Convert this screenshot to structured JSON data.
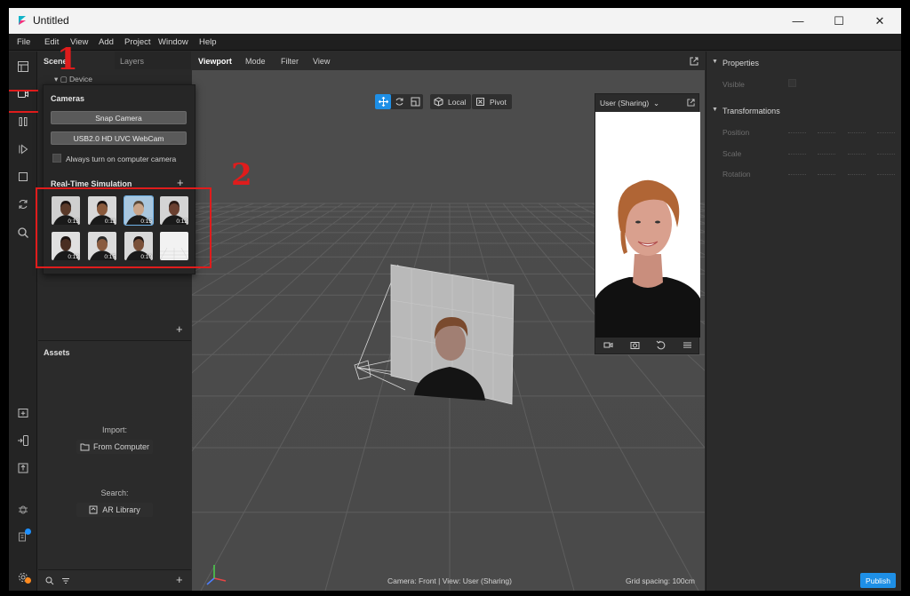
{
  "window": {
    "title": "Untitled",
    "minimize_glyph": "—",
    "maximize_glyph": "☐",
    "close_glyph": "✕"
  },
  "menu": [
    "File",
    "Edit",
    "View",
    "Add",
    "Project",
    "Window",
    "Help"
  ],
  "left_panel": {
    "tabs": [
      "Scene",
      "Layers"
    ],
    "device_label": "Device"
  },
  "cameras_popover": {
    "title": "Cameras",
    "snap_camera": "Snap Camera",
    "webcam": "USB2.0 HD UVC WebCam",
    "always_on_label": "Always turn on computer camera",
    "simulation_title": "Real-Time Simulation",
    "thumbnails": [
      {
        "duration": "0:13",
        "skin": "#5a3a2a",
        "hair": "#1a1210",
        "bg": "#cfcfcf"
      },
      {
        "duration": "0:11",
        "skin": "#8a5a3c",
        "hair": "#1a1210",
        "bg": "#d8d8d8"
      },
      {
        "duration": "0:15",
        "skin": "#c9a58a",
        "hair": "#5a4a3a",
        "bg": "#a9c7df"
      },
      {
        "duration": "0:12",
        "skin": "#6a4030",
        "hair": "#2a1a14",
        "bg": "#d4d4d4"
      },
      {
        "duration": "0:12",
        "skin": "#4a2e22",
        "hair": "#1a1210",
        "bg": "#e0e0e0"
      },
      {
        "duration": "0:15",
        "skin": "#8a5c40",
        "hair": "#2a2a2a",
        "bg": "#dcdcdc"
      },
      {
        "duration": "0:10",
        "skin": "#7a5038",
        "hair": "#1a1210",
        "bg": "#d8d8d8"
      },
      {
        "duration": "",
        "skin": "",
        "hair": "",
        "bg": "#f2f2f2"
      }
    ]
  },
  "annotations": {
    "one": "1",
    "two": "2"
  },
  "assets": {
    "title": "Assets",
    "import_label": "Import:",
    "from_computer": "From Computer",
    "search_label": "Search:",
    "ar_library": "AR Library"
  },
  "viewport": {
    "tabs": [
      "Viewport",
      "Mode",
      "Filter",
      "View"
    ],
    "local_label": "Local",
    "pivot_label": "Pivot",
    "status_camera": "Camera: Front | View: User (Sharing)",
    "status_grid": "Grid spacing: 100cm"
  },
  "preview": {
    "title": "User (Sharing)"
  },
  "properties": {
    "title": "Properties",
    "visible_label": "Visible",
    "transformations_title": "Transformations",
    "rows": [
      "Position",
      "Scale",
      "Rotation"
    ]
  },
  "publish_label": "Publish",
  "colors": {
    "accent": "#1e8fe6",
    "highlight": "#e01c1c"
  }
}
